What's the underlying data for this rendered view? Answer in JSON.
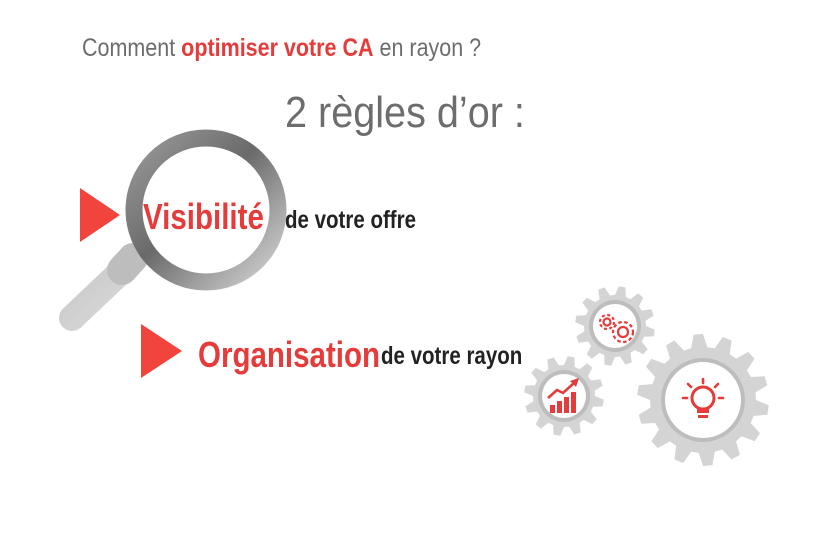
{
  "headline": {
    "prefix": "Comment",
    "highlight": "optimiser votre CA",
    "suffix": "en rayon ?"
  },
  "subtitle": "2 règles d’or :",
  "rules": [
    {
      "keyword": "Visibilité",
      "rest": "de votre offre"
    },
    {
      "keyword": "Organisation",
      "rest": "de votre rayon"
    }
  ],
  "colors": {
    "accent": "#e63b3b",
    "gray_text": "#6d6d6d",
    "dark_text": "#222222",
    "gear": "#d4d4d4"
  },
  "icons": [
    "magnifier-icon",
    "triangle-bullet-icon",
    "gear-icon",
    "small-gears-icon",
    "growth-chart-icon",
    "light-bulb-icon"
  ]
}
